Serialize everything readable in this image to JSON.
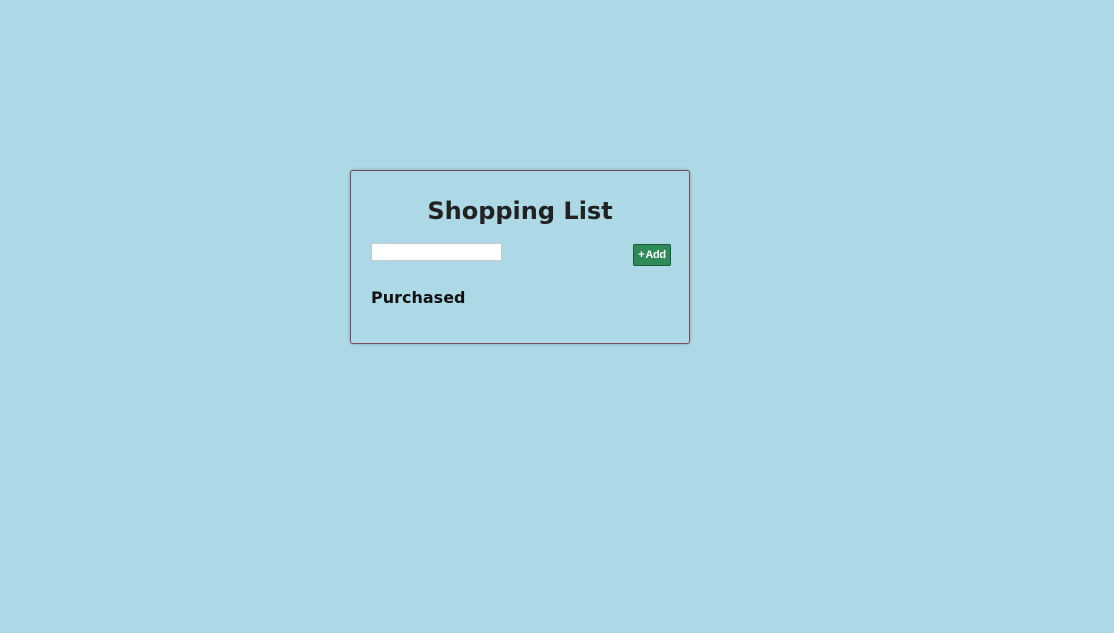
{
  "app": {
    "title": "Shopping List"
  },
  "form": {
    "input_value": "",
    "input_placeholder": "",
    "add_icon": "+",
    "add_label": "Add"
  },
  "purchased": {
    "heading": "Purchased",
    "items": []
  },
  "colors": {
    "background": "#add8e6",
    "add_button": "#2e8b57",
    "card_border": "#7a4a5a"
  }
}
